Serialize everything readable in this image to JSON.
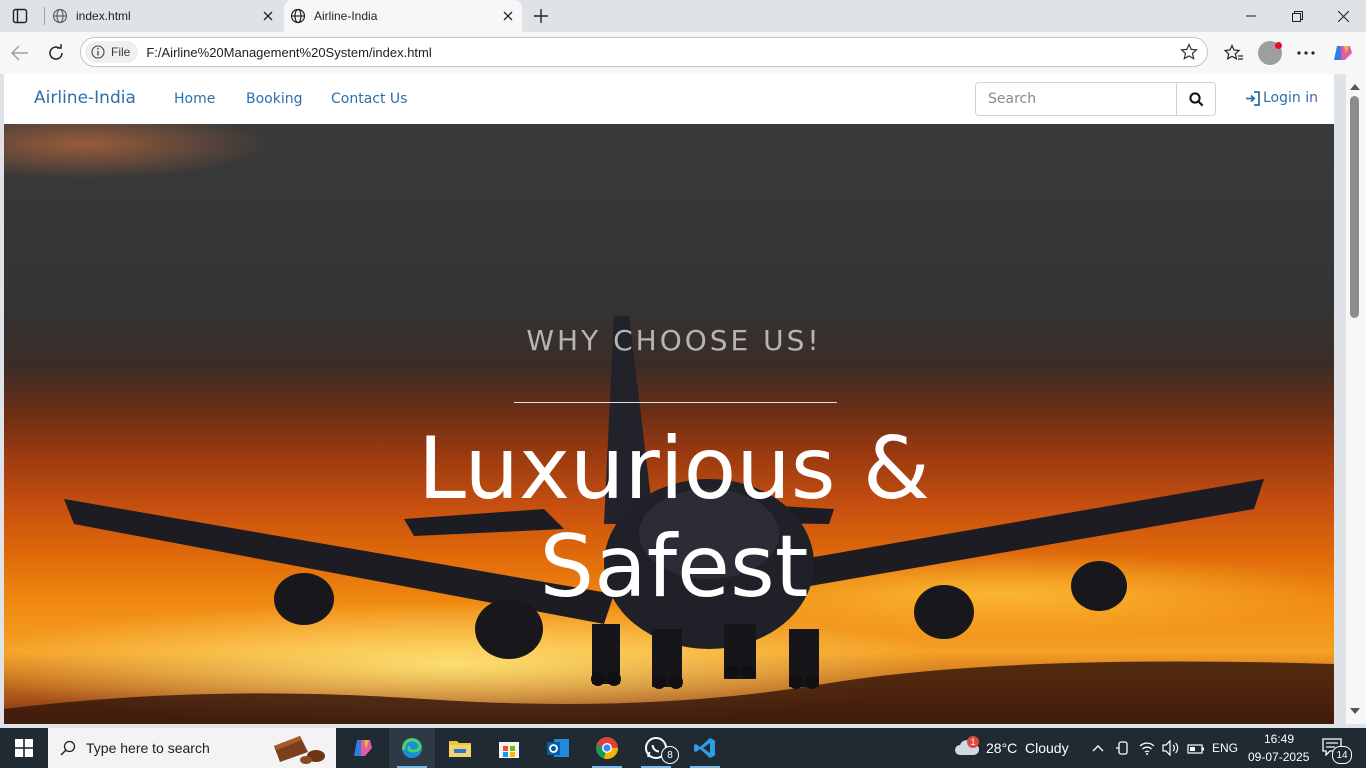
{
  "browser": {
    "tabs": [
      {
        "label": "index.html",
        "active": false
      },
      {
        "label": "Airline-India",
        "active": true
      }
    ],
    "site_info_label": "File",
    "url": "F:/Airline%20Management%20System/index.html"
  },
  "navbar": {
    "brand": "Airline-India",
    "links": [
      "Home",
      "Booking",
      "Contact Us"
    ],
    "search_placeholder": "Search",
    "login_label": "Login in",
    "link_color": "#2c6fad"
  },
  "hero": {
    "subtitle": "WHY CHOOSE US!",
    "title_line1": "Luxurious &",
    "title_line2": "Safest"
  },
  "taskbar": {
    "search_placeholder": "Type here to search",
    "weather_temp": "28°C",
    "weather_desc": "Cloudy",
    "weather_badge": "1",
    "language": "ENG",
    "time": "16:49",
    "date": "09-07-2025",
    "notification_count": "14",
    "whatsapp_badge": "8"
  }
}
